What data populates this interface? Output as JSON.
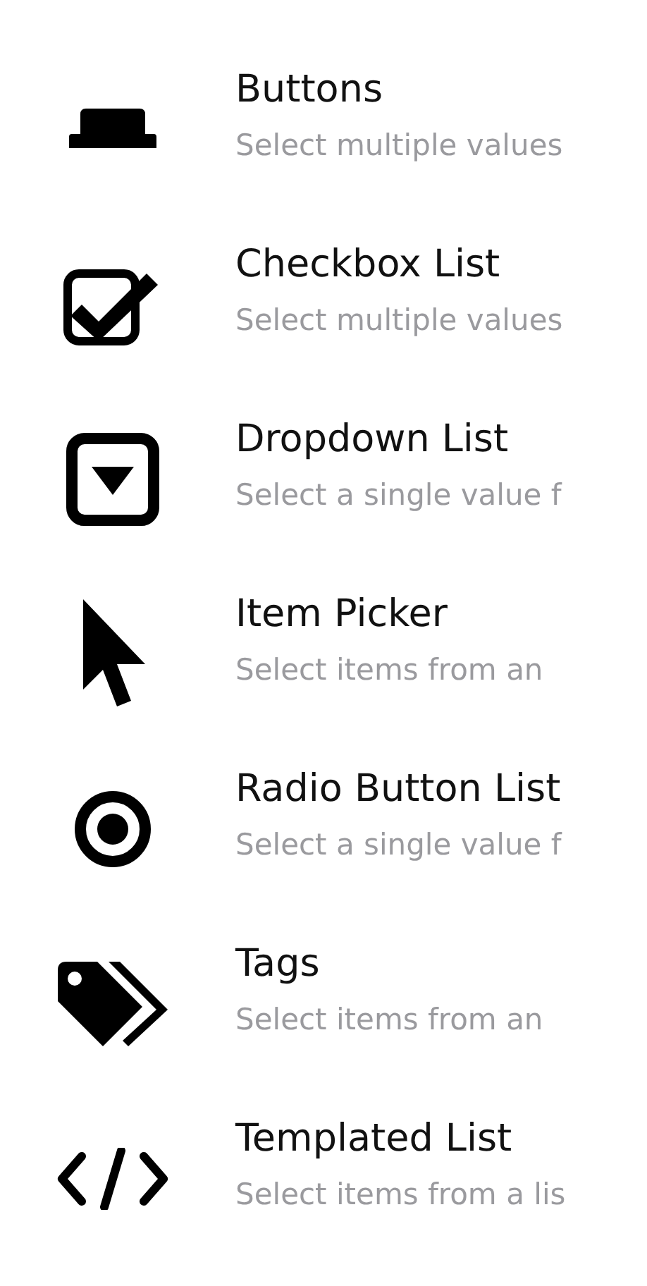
{
  "items": [
    {
      "title": "Buttons",
      "subtitle": "Select multiple values"
    },
    {
      "title": "Checkbox List",
      "subtitle": "Select multiple values"
    },
    {
      "title": "Dropdown List",
      "subtitle": "Select a single value f"
    },
    {
      "title": "Item Picker",
      "subtitle": "Select items from an"
    },
    {
      "title": "Radio Button List",
      "subtitle": "Select a single value f"
    },
    {
      "title": "Tags",
      "subtitle": "Select items from an"
    },
    {
      "title": "Templated List",
      "subtitle": "Select items from a lis"
    }
  ]
}
